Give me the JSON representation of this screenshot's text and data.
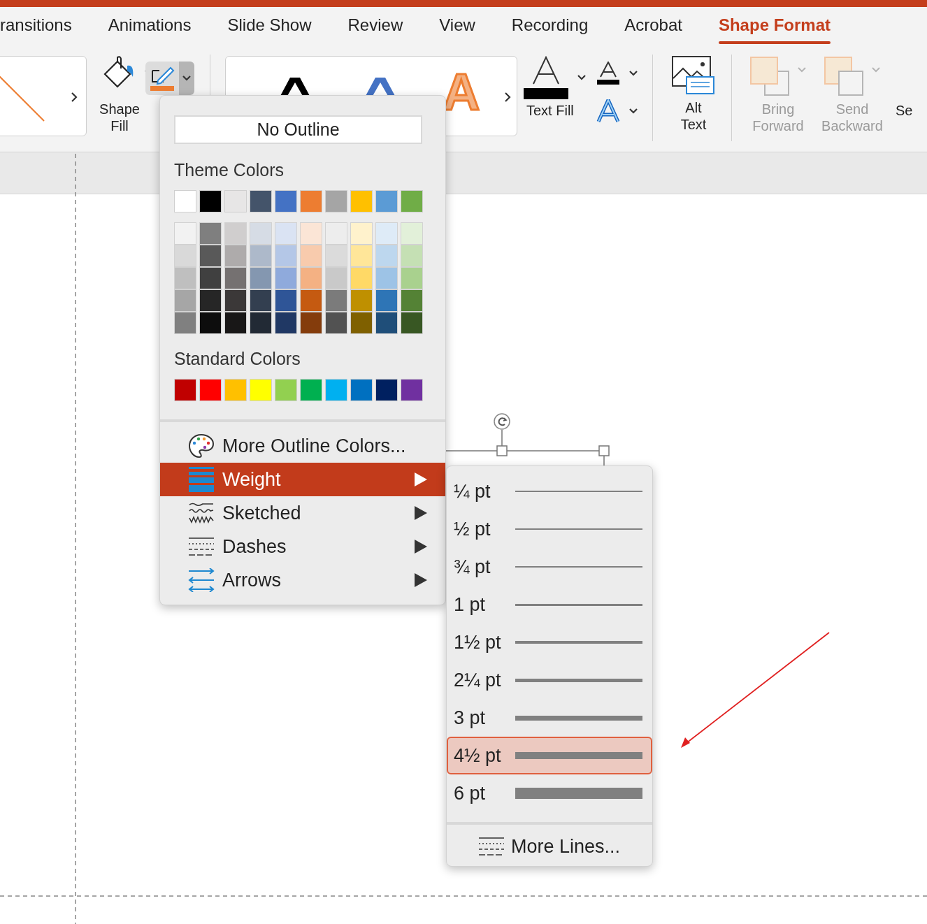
{
  "tabs": [
    {
      "label": "ransitions",
      "selected": false
    },
    {
      "label": "Animations",
      "selected": false
    },
    {
      "label": "Slide Show",
      "selected": false
    },
    {
      "label": "Review",
      "selected": false
    },
    {
      "label": "View",
      "selected": false
    },
    {
      "label": "Recording",
      "selected": false
    },
    {
      "label": "Acrobat",
      "selected": false
    },
    {
      "label": "Shape Format",
      "selected": true
    }
  ],
  "ribbon": {
    "shape_fill": {
      "label": "Shape Fill"
    },
    "shape_outline": {
      "expanded": true
    },
    "wordart_previews": [
      {
        "color": "#000000"
      },
      {
        "color": "#4472c4"
      },
      {
        "text": "A",
        "color": "#f4b183"
      }
    ],
    "text_fill": {
      "label": "Text Fill"
    },
    "alt_text": {
      "label": "Alt Text"
    },
    "arrange": [
      {
        "label": "Bring Forward",
        "disabled": true
      },
      {
        "label": "Send Backward",
        "disabled": true
      }
    ],
    "cut_off_label": "Se"
  },
  "outline_menu": {
    "no_outline": "No Outline",
    "theme_heading": "Theme Colors",
    "theme_colors": [
      {
        "color": "#ffffff",
        "shades": [
          {
            "color": "#f2f2f2"
          },
          {
            "color": "#d9d9d9"
          },
          {
            "color": "#bfbfbf"
          },
          {
            "color": "#a6a6a6"
          },
          {
            "color": "#808080"
          }
        ]
      },
      {
        "color": "#000000",
        "shades": [
          {
            "color": "#7f7f7f"
          },
          {
            "color": "#595959"
          },
          {
            "color": "#404040"
          },
          {
            "color": "#262626"
          },
          {
            "color": "#0d0d0d"
          }
        ]
      },
      {
        "color": "#e7e6e6",
        "shades": [
          {
            "color": "#d0cece"
          },
          {
            "color": "#aeabab"
          },
          {
            "color": "#757171"
          },
          {
            "color": "#3b3838"
          },
          {
            "color": "#181717"
          }
        ]
      },
      {
        "color": "#44546a",
        "shades": [
          {
            "color": "#d6dce5"
          },
          {
            "color": "#adb9ca"
          },
          {
            "color": "#8497b0"
          },
          {
            "color": "#333f50"
          },
          {
            "color": "#222a35"
          }
        ]
      },
      {
        "color": "#4472c4",
        "shades": [
          {
            "color": "#dae3f3"
          },
          {
            "color": "#b4c7e7"
          },
          {
            "color": "#8faadc"
          },
          {
            "color": "#2f5597"
          },
          {
            "color": "#203864"
          }
        ]
      },
      {
        "color": "#ed7d31",
        "shades": [
          {
            "color": "#fbe5d6"
          },
          {
            "color": "#f8cbad"
          },
          {
            "color": "#f4b183"
          },
          {
            "color": "#c55a11"
          },
          {
            "color": "#843c0c"
          }
        ]
      },
      {
        "color": "#a5a5a5",
        "shades": [
          {
            "color": "#ededed"
          },
          {
            "color": "#dbdbdb"
          },
          {
            "color": "#c9c9c9"
          },
          {
            "color": "#7b7b7b"
          },
          {
            "color": "#525252"
          }
        ]
      },
      {
        "color": "#ffc000",
        "shades": [
          {
            "color": "#fff2cc"
          },
          {
            "color": "#ffe699"
          },
          {
            "color": "#ffd966"
          },
          {
            "color": "#bf9000"
          },
          {
            "color": "#7f6000"
          }
        ]
      },
      {
        "color": "#5b9bd5",
        "shades": [
          {
            "color": "#deebf7"
          },
          {
            "color": "#bdd7ee"
          },
          {
            "color": "#9dc3e6"
          },
          {
            "color": "#2e75b6"
          },
          {
            "color": "#1f4e79"
          }
        ]
      },
      {
        "color": "#70ad47",
        "shades": [
          {
            "color": "#e2f0d9"
          },
          {
            "color": "#c5e0b4"
          },
          {
            "color": "#a9d18e"
          },
          {
            "color": "#548235"
          },
          {
            "color": "#385723"
          }
        ]
      }
    ],
    "standard_heading": "Standard Colors",
    "standard_colors": [
      {
        "color": "#c00000"
      },
      {
        "color": "#ff0000"
      },
      {
        "color": "#ffc000"
      },
      {
        "color": "#ffff00"
      },
      {
        "color": "#92d050"
      },
      {
        "color": "#00b050"
      },
      {
        "color": "#00b0f0"
      },
      {
        "color": "#0070c0"
      },
      {
        "color": "#002060"
      },
      {
        "color": "#7030a0"
      }
    ],
    "items": [
      {
        "kind": "palette",
        "label": "More Outline Colors...",
        "selected": false,
        "submenu": false
      },
      {
        "kind": "weight",
        "label": "Weight",
        "selected": true,
        "submenu": true
      },
      {
        "kind": "sketched",
        "label": "Sketched",
        "selected": false,
        "submenu": true
      },
      {
        "kind": "dashes",
        "label": "Dashes",
        "selected": false,
        "submenu": true
      },
      {
        "kind": "arrows",
        "label": "Arrows",
        "selected": false,
        "submenu": true
      }
    ]
  },
  "weight_menu": {
    "items": [
      {
        "label": "¼ pt",
        "selected": false
      },
      {
        "label": "½ pt",
        "selected": false
      },
      {
        "label": "¾ pt",
        "selected": false
      },
      {
        "label": "1 pt",
        "selected": false
      },
      {
        "label": "1½ pt",
        "selected": false
      },
      {
        "label": "2¼ pt",
        "selected": false
      },
      {
        "label": "3 pt",
        "selected": false
      },
      {
        "label": "4½ pt",
        "selected": true
      },
      {
        "label": "6 pt",
        "selected": false
      }
    ],
    "more_lines": "More Lines..."
  }
}
